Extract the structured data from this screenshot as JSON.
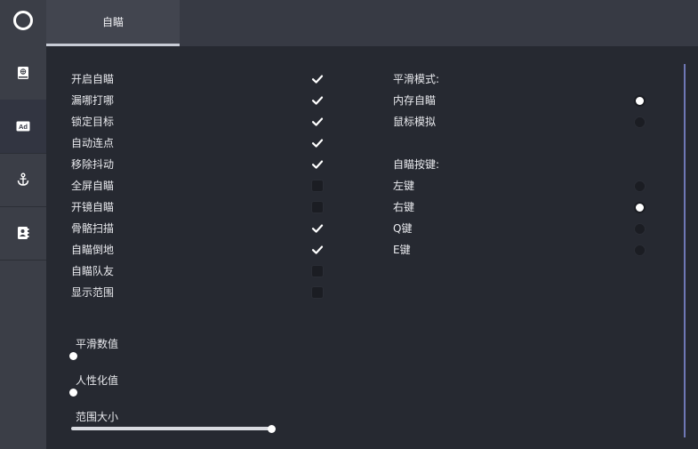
{
  "sidebar": {
    "items": [
      {
        "icon": "book-globe-icon"
      },
      {
        "icon": "ad-icon",
        "label": "Ad"
      },
      {
        "icon": "anchor-icon"
      },
      {
        "icon": "contact-book-icon"
      }
    ]
  },
  "tabs": [
    {
      "label": "自瞄"
    }
  ],
  "options": [
    {
      "label": "开启自瞄",
      "checked": true
    },
    {
      "label": "漏哪打哪",
      "checked": true
    },
    {
      "label": "锁定目标",
      "checked": true
    },
    {
      "label": "自动连点",
      "checked": true
    },
    {
      "label": "移除抖动",
      "checked": true
    },
    {
      "label": "全屏自瞄",
      "checked": false
    },
    {
      "label": "开镜自瞄",
      "checked": false
    },
    {
      "label": "骨骼扫描",
      "checked": true
    },
    {
      "label": "自瞄倒地",
      "checked": true
    },
    {
      "label": "自瞄队友",
      "checked": false
    },
    {
      "label": "显示范围",
      "checked": false
    }
  ],
  "smooth_mode": {
    "title": "平滑模式:",
    "options": [
      {
        "label": "内存自瞄",
        "selected": true
      },
      {
        "label": "鼠标模拟",
        "selected": false
      }
    ]
  },
  "aim_key": {
    "title": "自瞄按键:",
    "options": [
      {
        "label": "左键",
        "selected": false
      },
      {
        "label": "右键",
        "selected": true
      },
      {
        "label": "Q键",
        "selected": false
      },
      {
        "label": "E键",
        "selected": false
      }
    ]
  },
  "sliders": [
    {
      "label": "平滑数值",
      "value": 0.0
    },
    {
      "label": "人性化值",
      "value": 0.0
    },
    {
      "label": "范围大小",
      "value": 1.0
    }
  ],
  "colors": {
    "accent": "#6f78b6",
    "background": "#262931",
    "sidebar": "#3b3e47"
  }
}
